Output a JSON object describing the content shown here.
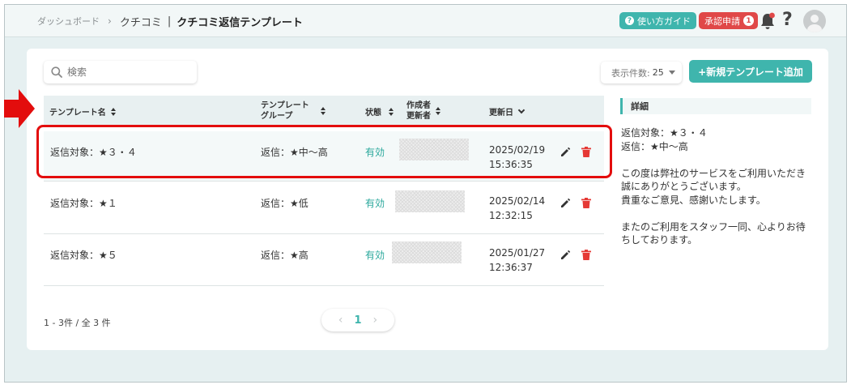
{
  "breadcrumb": {
    "dashboard": "ダッシュボード",
    "section": "クチコミ",
    "current": "クチコミ返信テンプレート"
  },
  "header": {
    "guide_label": "使い方ガイド",
    "approval_label": "承認申請",
    "approval_count": "1",
    "help_label": "?"
  },
  "toolbar": {
    "search_placeholder": "検索",
    "perpage_label": "表示件数:",
    "perpage_value": "25",
    "add_label": "+新規テンプレート追加"
  },
  "table": {
    "headers": {
      "name": "テンプレート名",
      "group_l1": "テンプレート",
      "group_l2": "グループ",
      "status": "状態",
      "creator_l1": "作成者",
      "creator_l2": "更新者",
      "updated": "更新日"
    },
    "rows": [
      {
        "name": "返信対象：★３・４",
        "group": "返信：★中〜高",
        "status": "有効",
        "date": "2025/02/19",
        "time": "15:36:35"
      },
      {
        "name": "返信対象：★１",
        "group": "返信：★低",
        "status": "有効",
        "date": "2025/02/14",
        "time": "12:32:15"
      },
      {
        "name": "返信対象：★５",
        "group": "返信：★高",
        "status": "有効",
        "date": "2025/01/27",
        "time": "12:36:37"
      }
    ]
  },
  "detail": {
    "title": "詳細",
    "line1": "返信対象：★３・４",
    "line2": "返信：★中〜高",
    "line3": "この度は弊社のサービスをご利用いただき",
    "line4": "誠にありがとうございます。",
    "line5": "貴重なご意見、感謝いたします。",
    "line6": "またのご利用をスタッフ一同、心よりお待",
    "line7": "ちしております。"
  },
  "footer": {
    "count": "1 - 3件 / 全 3 件",
    "page": "1",
    "prev": "‹",
    "next": "›"
  },
  "colors": {
    "accent": "#3fb5ad",
    "danger": "#e04848",
    "highlight": "#e30d0d"
  },
  "icons": [
    "question-icon",
    "bell-icon",
    "avatar-icon",
    "search-icon",
    "sort-icon",
    "chevron-down-icon",
    "edit-icon",
    "trash-icon",
    "arrow-right-icon"
  ]
}
